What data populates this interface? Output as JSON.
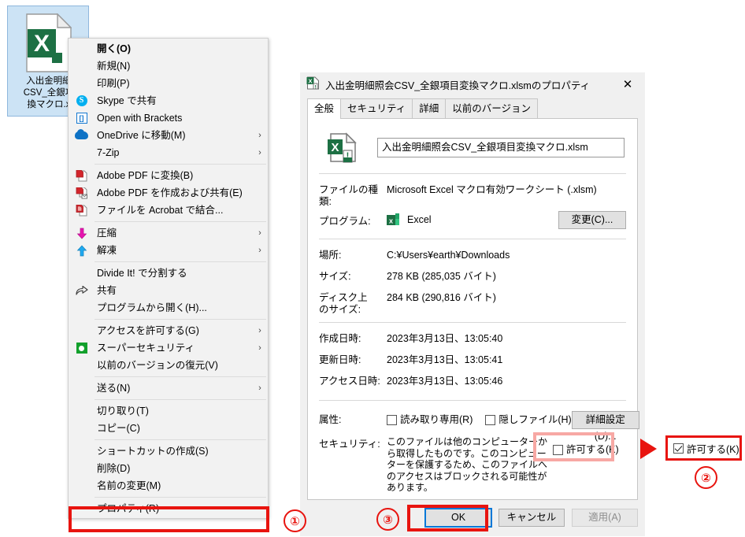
{
  "desktop": {
    "file_icon": {
      "name": "入出金明細\nCSV_全銀項\n換マクロ.x",
      "line1": "入出金明細",
      "line2": "CSV_全銀項",
      "line3": "換マクロ.x",
      "app_glyph": "X"
    }
  },
  "context_menu": {
    "items": [
      {
        "label": "開く(O)",
        "icon": "",
        "bold": true,
        "arrow": ""
      },
      {
        "label": "新規(N)",
        "icon": "",
        "bold": false,
        "arrow": ""
      },
      {
        "label": "印刷(P)",
        "icon": "",
        "bold": false,
        "arrow": ""
      },
      {
        "label": "Skype で共有",
        "icon": "skype-icon",
        "bold": false,
        "arrow": ""
      },
      {
        "label": "Open with Brackets",
        "icon": "brackets-icon",
        "bold": false,
        "arrow": ""
      },
      {
        "label": "OneDrive に移動(M)",
        "icon": "onedrive-icon",
        "bold": false,
        "arrow": "›"
      },
      {
        "label": "7-Zip",
        "icon": "",
        "bold": false,
        "arrow": "›"
      },
      {
        "separator": true
      },
      {
        "label": "Adobe PDF に変換(B)",
        "icon": "adobe-pdf-convert-icon",
        "bold": false,
        "arrow": ""
      },
      {
        "label": "Adobe PDF を作成および共有(E)",
        "icon": "adobe-pdf-share-icon",
        "bold": false,
        "arrow": ""
      },
      {
        "label": "ファイルを Acrobat で結合...",
        "icon": "adobe-combine-icon",
        "bold": false,
        "arrow": ""
      },
      {
        "separator": true
      },
      {
        "label": "圧縮",
        "icon": "arrow-down-icon",
        "bold": false,
        "arrow": "›"
      },
      {
        "label": "解凍",
        "icon": "arrow-up-icon",
        "bold": false,
        "arrow": "›"
      },
      {
        "separator": true
      },
      {
        "label": "Divide It! で分割する",
        "icon": "",
        "bold": false,
        "arrow": ""
      },
      {
        "label": "共有",
        "icon": "share-icon",
        "bold": false,
        "arrow": ""
      },
      {
        "label": "プログラムから開く(H)...",
        "icon": "",
        "bold": false,
        "arrow": ""
      },
      {
        "separator": true
      },
      {
        "label": "アクセスを許可する(G)",
        "icon": "",
        "bold": false,
        "arrow": "›"
      },
      {
        "label": "スーパーセキュリティ",
        "icon": "shield-icon",
        "bold": false,
        "arrow": "›"
      },
      {
        "label": "以前のバージョンの復元(V)",
        "icon": "",
        "bold": false,
        "arrow": ""
      },
      {
        "separator": true
      },
      {
        "label": "送る(N)",
        "icon": "",
        "bold": false,
        "arrow": "›"
      },
      {
        "separator": true
      },
      {
        "label": "切り取り(T)",
        "icon": "",
        "bold": false,
        "arrow": ""
      },
      {
        "label": "コピー(C)",
        "icon": "",
        "bold": false,
        "arrow": ""
      },
      {
        "separator": true
      },
      {
        "label": "ショートカットの作成(S)",
        "icon": "",
        "bold": false,
        "arrow": ""
      },
      {
        "label": "削除(D)",
        "icon": "",
        "bold": false,
        "arrow": ""
      },
      {
        "label": "名前の変更(M)",
        "icon": "",
        "bold": false,
        "arrow": ""
      },
      {
        "separator": true
      },
      {
        "label": "プロパティ(R)",
        "icon": "",
        "bold": false,
        "arrow": ""
      }
    ]
  },
  "dialog": {
    "title": "入出金明細照会CSV_全銀項目変換マクロ.xlsmのプロパティ",
    "close_glyph": "✕",
    "tabs": [
      {
        "label": "全般",
        "active": true
      },
      {
        "label": "セキュリティ",
        "active": false
      },
      {
        "label": "詳細",
        "active": false
      },
      {
        "label": "以前のバージョン",
        "active": false
      }
    ],
    "filename_value": "入出金明細照会CSV_全銀項目変換マクロ.xlsm",
    "fields": {
      "filetype_label": "ファイルの種類:",
      "filetype_value": "Microsoft Excel マクロ有効ワークシート (.xlsm)",
      "program_label": "プログラム:",
      "program_value": "Excel",
      "change_button": "変更(C)...",
      "location_label": "場所:",
      "location_value": "C:¥Users¥earth¥Downloads",
      "size_label": "サイズ:",
      "size_value": "278 KB (285,035 バイト)",
      "disksize_label": "ディスク上\nのサイズ:",
      "disksize_label_l1": "ディスク上",
      "disksize_label_l2": "のサイズ:",
      "disksize_value": "284 KB (290,816 バイト)",
      "created_label": "作成日時:",
      "created_value": "2023年3月13日、13:05:40",
      "modified_label": "更新日時:",
      "modified_value": "2023年3月13日、13:05:41",
      "accessed_label": "アクセス日時:",
      "accessed_value": "2023年3月13日、13:05:46",
      "attributes_label": "属性:",
      "readonly_label": "読み取り専用(R)",
      "readonly_checked": false,
      "hidden_label": "隠しファイル(H)",
      "hidden_checked": false,
      "advanced_button": "詳細設定(D)...",
      "security_label": "セキュリティ:",
      "security_text": "このファイルは他のコンピューターから取得したものです。このコンピューターを保護するため、このファイルへのアクセスはブロックされる可能性があります。",
      "unblock_label": "許可する(K)",
      "unblock_checked": false
    },
    "buttons": {
      "ok": "OK",
      "cancel": "キャンセル",
      "apply": "適用(A)"
    }
  },
  "annotations": {
    "badge_1": "①",
    "badge_2": "②",
    "badge_3": "③",
    "callout_checkbox_label": "許可する(K)",
    "callout_checkbox_checked": true,
    "highlight_color": "#e8140f",
    "soft_highlight_color": "#f7a8a4"
  }
}
